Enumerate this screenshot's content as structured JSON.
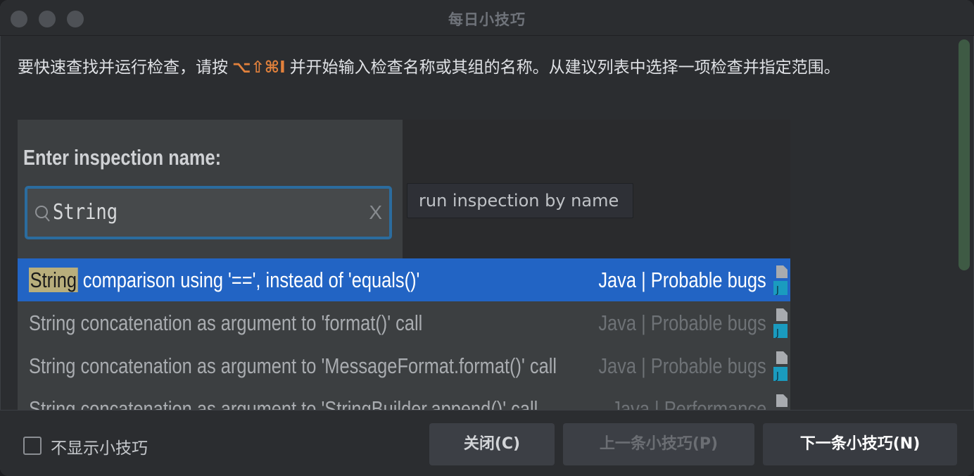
{
  "window": {
    "title": "每日小技巧"
  },
  "tip": {
    "text_before": "要快速查找并运行检查，请按",
    "shortcut": "⌥⇧⌘I",
    "text_after": "并开始输入检查名称或其组的名称。从建议列表中选择一项检查并指定范围。"
  },
  "illustration": {
    "popup_label": "Enter inspection name:",
    "search_value": "String",
    "clear_glyph": "X",
    "hint": "run inspection by name",
    "results": [
      {
        "name_highlight": "String",
        "name_rest": " comparison using '==', instead of 'equals()'",
        "category": "Java | Probable bugs",
        "selected": true
      },
      {
        "name_highlight": "",
        "name_rest": "String concatenation as argument to 'format()' call",
        "category": "Java | Probable bugs",
        "selected": false
      },
      {
        "name_highlight": "",
        "name_rest": "String concatenation as argument to 'MessageFormat.format()' call",
        "category": "Java | Probable bugs",
        "selected": false
      },
      {
        "name_highlight": "",
        "name_rest": "String concatenation as argument to 'StringBuilder.append()' call",
        "category": "Java | Performance",
        "selected": false
      }
    ],
    "file_icon_letter": "J"
  },
  "footer": {
    "dont_show_label": "不显示小技巧",
    "dont_show_checked": false,
    "close_button": "关闭(C)",
    "prev_button": "上一条小技巧(P)",
    "next_button": "下一条小技巧(N)"
  },
  "colors": {
    "accent_shortcut": "#e2813c",
    "selection": "#2264c4",
    "search_highlight": "#b8ae7c",
    "focus_border": "#2b6c9e"
  }
}
